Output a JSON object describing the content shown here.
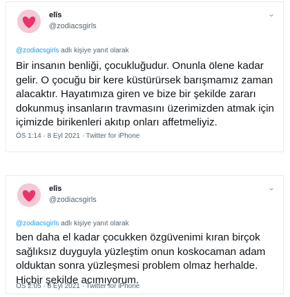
{
  "tweets": [
    {
      "display_name": "elîs",
      "handle": "@zodiacsgirls",
      "reply_mention": "@zodiacsgirls",
      "reply_suffix": " adlı kişiye yanıt olarak",
      "text": "Bir insanın benliği, çocukluğudur. Onunla ölene kadar gelir. O çocuğu bir kere küstürürsek barışmamız zaman alacaktır. Hayatımıza giren ve bize bir şekilde zararı dokunmuş insanların travmasını üzerimizden atmak için içimizde birikenleri akıtıp onları affetmeliyiz.",
      "meta": "ÖS 1:14 · 8 Eyl 2021 · Twitter for iPhone"
    },
    {
      "display_name": "elîs",
      "handle": "@zodiacsgirls",
      "reply_mention": "@zodiacsgirls",
      "reply_suffix": " adlı kişiye yanıt olarak",
      "text": "ben daha el kadar çocukken özgüvenimi kıran birçok sağlıksız duyguyla yüzleştim onun koskocaman adam olduktan sonra yüzleşmesi problem olmaz herhalde. Hiçbir şekilde acımıyorum.",
      "meta": "ÖS 2:05 · 8 Eyl 2021 · Twitter for iPhone"
    }
  ],
  "icons": {
    "avatar": "pink-heart-avatar",
    "menu": "chevron-down-icon"
  },
  "colors": {
    "link": "#1d9bf0",
    "avatar_heart": "#e8336b",
    "avatar_bg": "#f4c9d6"
  }
}
